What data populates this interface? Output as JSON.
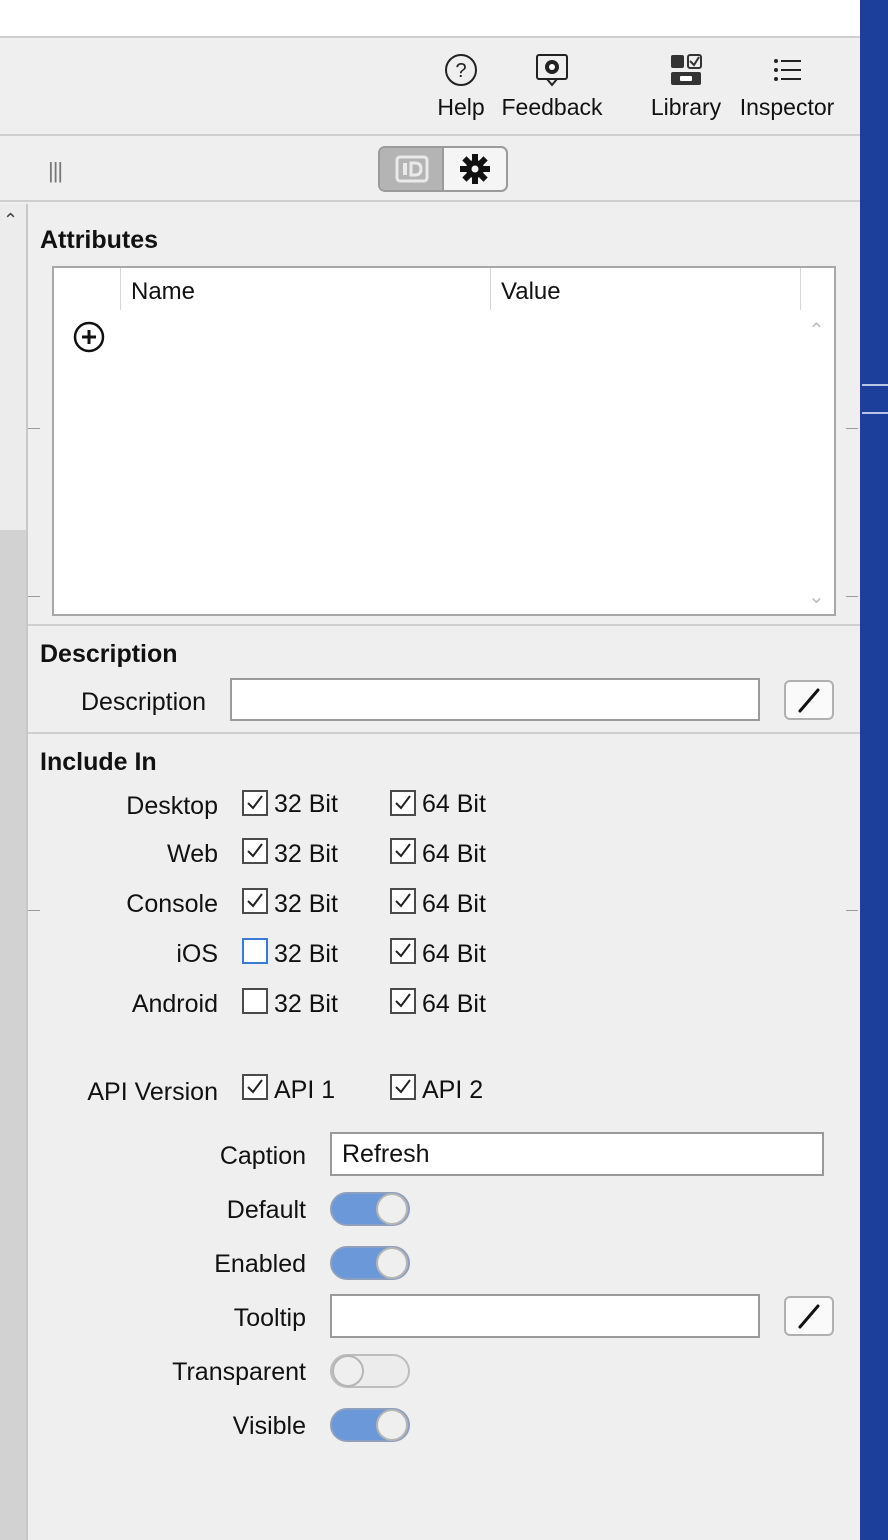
{
  "toolbar": {
    "help": "Help",
    "feedback": "Feedback",
    "library": "Library",
    "inspector": "Inspector"
  },
  "subbar": {
    "grip": "|||"
  },
  "attributes": {
    "title": "Attributes",
    "columns": [
      "Name",
      "Value"
    ]
  },
  "description": {
    "title": "Description",
    "label": "Description",
    "value": ""
  },
  "include_in": {
    "title": "Include In",
    "rows": [
      {
        "label": "Desktop",
        "bit32": {
          "label": "32 Bit",
          "checked": true
        },
        "bit64": {
          "label": "64 Bit",
          "checked": true
        }
      },
      {
        "label": "Web",
        "bit32": {
          "label": "32 Bit",
          "checked": true
        },
        "bit64": {
          "label": "64 Bit",
          "checked": true
        }
      },
      {
        "label": "Console",
        "bit32": {
          "label": "32 Bit",
          "checked": true
        },
        "bit64": {
          "label": "64 Bit",
          "checked": true
        }
      },
      {
        "label": "iOS",
        "bit32": {
          "label": "32 Bit",
          "checked": false
        },
        "bit64": {
          "label": "64 Bit",
          "checked": true
        }
      },
      {
        "label": "Android",
        "bit32": {
          "label": "32 Bit",
          "checked": false
        },
        "bit64": {
          "label": "64 Bit",
          "checked": true
        }
      }
    ],
    "api": {
      "label": "API Version",
      "api1": {
        "label": "API 1",
        "checked": true
      },
      "api2": {
        "label": "API 2",
        "checked": true
      }
    }
  },
  "properties": {
    "caption": {
      "label": "Caption",
      "value": "Refresh"
    },
    "default": {
      "label": "Default",
      "on": true
    },
    "enabled": {
      "label": "Enabled",
      "on": true
    },
    "tooltip": {
      "label": "Tooltip",
      "value": ""
    },
    "transparent": {
      "label": "Transparent",
      "on": false
    },
    "visible": {
      "label": "Visible",
      "on": true
    }
  },
  "colors": {
    "accent": "#6b98d8",
    "right_bar": "#1c3f9c",
    "focus": "#3a7bd5"
  }
}
